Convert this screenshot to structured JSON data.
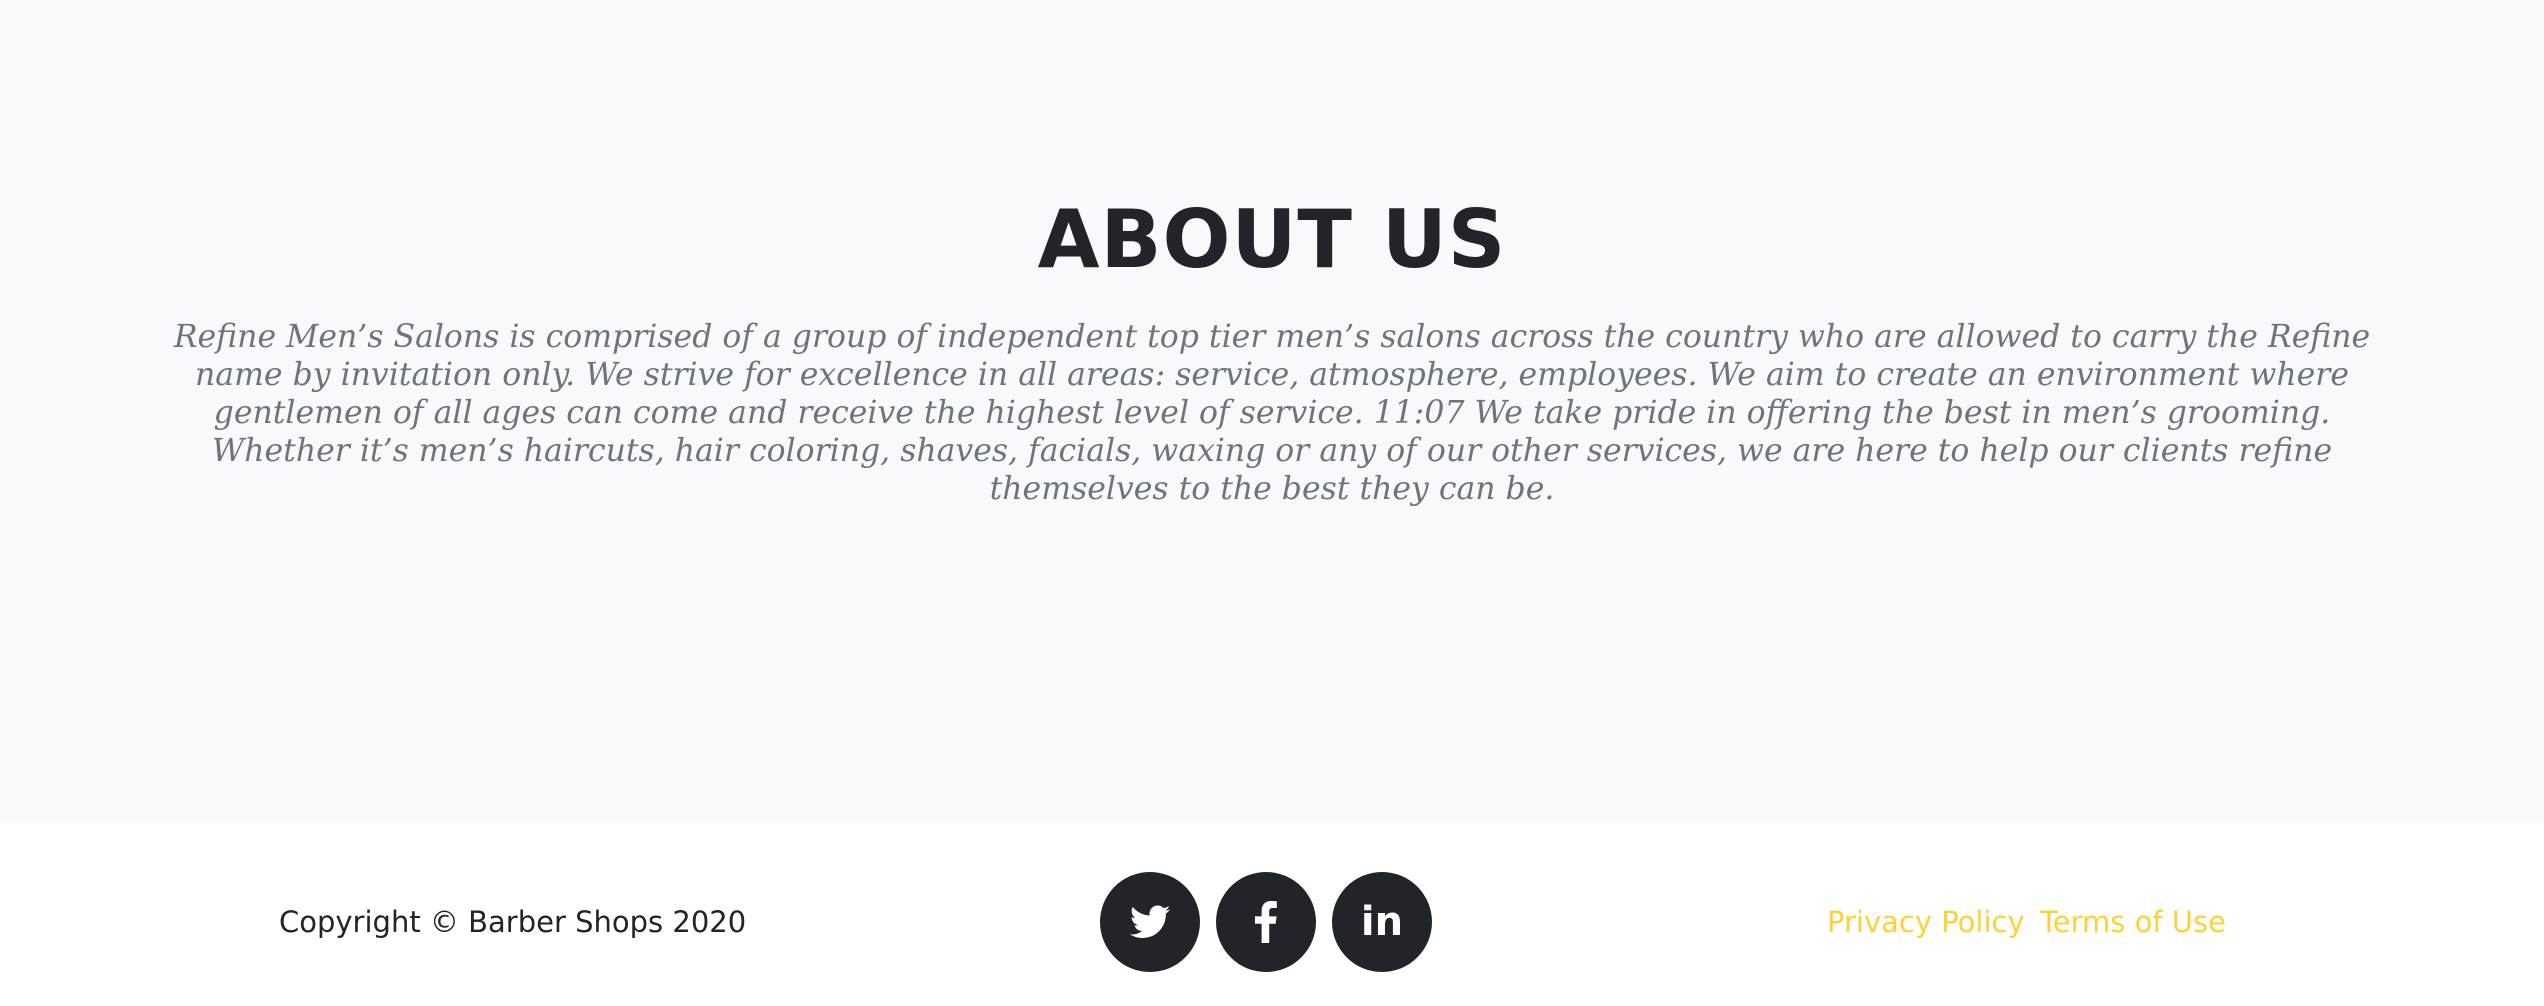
{
  "about": {
    "title": "ABOUT US",
    "text": "Refine Men’s Salons is comprised of a group of independent top tier men’s salons across the country who are allowed to carry the Refine name by invitation only. We strive for excellence in all areas: service, atmosphere, employees. We aim to create an environment where gentlemen of all ages can come and receive the highest level of service. 11:07 We take pride in offering the best in men’s grooming. Whether it’s men’s haircuts, hair coloring, shaves, facials, waxing or any of our other services, we are here to help our clients refine themselves to the best they can be."
  },
  "footer": {
    "copyright": "Copyright © Barber Shops 2020",
    "social": [
      {
        "icon": "twitter-icon"
      },
      {
        "icon": "facebook-icon"
      },
      {
        "icon": "linkedin-icon",
        "glyph": "in"
      }
    ],
    "links": {
      "privacy": "Privacy Policy",
      "terms": "Terms of Use"
    }
  },
  "colors": {
    "section_background": "#f8f9fa",
    "heading": "#212529",
    "body_text": "#6c757d",
    "social_button": "#212529",
    "link_accent": "#fed136"
  }
}
